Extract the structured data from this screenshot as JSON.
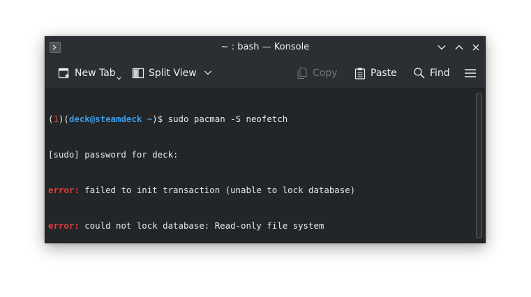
{
  "window": {
    "title": "~ : bash — Konsole"
  },
  "toolbar": {
    "new_tab": "New Tab",
    "split_view": "Split View",
    "copy": "Copy",
    "paste": "Paste",
    "find": "Find"
  },
  "terminal": {
    "prompt_open": "(",
    "prompt_status": "1",
    "prompt_mid": ")(",
    "prompt_user": "deck@steamdeck",
    "prompt_space": " ",
    "prompt_dir": "~",
    "prompt_close": ")$",
    "command": " sudo pacman -S neofetch",
    "sudo_line": "[sudo] password for deck:",
    "error_label": "error:",
    "error1_text": " failed to init transaction (unable to lock database)",
    "error2_text": " could not lock database: Read-only file system"
  },
  "colors": {
    "background": "#2b2e33",
    "terminal_bg": "#232629",
    "error": "#e03c3c",
    "user": "#3d9be3"
  }
}
